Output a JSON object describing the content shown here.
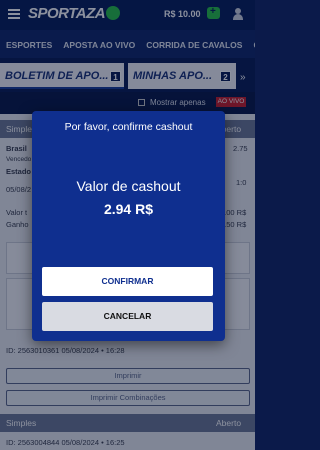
{
  "header": {
    "logo_text": "SPORTAZA",
    "balance": "R$ 10.00"
  },
  "nav": {
    "items": [
      "ESPORTES",
      "APOSTA AO VIVO",
      "CORRIDA DE CAVALOS",
      "CA"
    ]
  },
  "slip_tabs": {
    "tab1_label": "BOLETIM DE APO...",
    "tab1_badge": "1",
    "tab2_label": "MINHAS APO...",
    "tab2_badge": "2",
    "next_arrow": "»"
  },
  "filter": {
    "label": "Mostrar apenas",
    "live_badge": "AO VIVO"
  },
  "bets": {
    "bet1": {
      "type": "Simples",
      "status": "Aberto",
      "team": "Brasil",
      "odds": "2.75",
      "winner_label": "Vencedo",
      "state": "Estado",
      "live_score": "1:0",
      "date": "05/08/2",
      "valor_label": "Valor t",
      "valor_value": "0.00 R$",
      "ganho_label": "Ganho",
      "ganho_value": "7.50 R$",
      "id_line": "ID: 2563010361 05/08/2024 • 16:28"
    },
    "print_label": "Imprimir",
    "print_combos_label": "Imprimir Combinações",
    "bet2": {
      "type": "Simples",
      "status": "Aberto",
      "id_line": "ID: 2563004844 05/08/2024 • 16:25"
    }
  },
  "modal": {
    "title": "Por favor, confirme cashout",
    "label": "Valor de cashout",
    "value": "2.94 R$",
    "confirm_label": "CONFIRMAR",
    "cancel_label": "CANCELAR"
  }
}
